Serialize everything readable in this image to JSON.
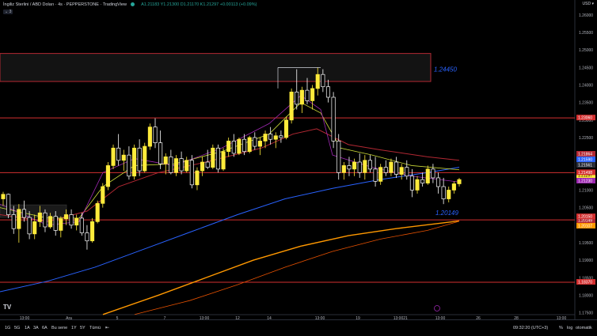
{
  "header": {
    "symbol": "İngiliz Sterlini / ABD Doları · 4s · PEPPERSTONE · TradingView",
    "ohlc": "A1.21183  Y1.21300  D1.21170  K1.21297  +0.00113 (+0.09%)",
    "collapse_label": "3",
    "currency": "USD ▾"
  },
  "chart_data": {
    "type": "line",
    "y_ticks": [
      "1.26000",
      "1.25500",
      "1.25000",
      "1.24500",
      "1.24000",
      "1.23500",
      "1.23000",
      "1.22500",
      "1.22000",
      "1.21500",
      "1.21000",
      "1.20500",
      "1.20000",
      "1.19500",
      "1.19000",
      "1.18500",
      "1.18000",
      "1.17500"
    ],
    "x_ticks": [
      "13:00",
      "Ara",
      "5",
      "7",
      "13:00",
      "12",
      "14",
      "13:00",
      "19",
      "13:00",
      "21",
      "13:00",
      "26",
      "28",
      "13:00"
    ],
    "zone_label": "1.24450",
    "support_label": "1.20149",
    "hlines": [
      {
        "price": 1.2306,
        "label": "1.23060"
      },
      {
        "price": 1.21498,
        "label": "1.21498"
      },
      {
        "price": 1.2015,
        "label": "1.20150"
      },
      {
        "price": 1.1837,
        "label": "1.18370"
      }
    ],
    "price_badges": [
      {
        "label": "1.21864",
        "color": "#b22833"
      },
      {
        "label": "1.21590",
        "color": "#2962ff"
      },
      {
        "label": "1.21561",
        "color": "#2a2e39"
      },
      {
        "label": "1.21297",
        "color": "#ffeb3b"
      },
      {
        "label": "1.21230",
        "color": "#9c27b0"
      },
      {
        "label": "1.20149",
        "color": "#b22833"
      },
      {
        "label": "1.20107",
        "color": "#ff9800"
      }
    ],
    "candles": [
      [
        1.2075,
        1.2095,
        1.2055,
        1.2088
      ],
      [
        1.2088,
        1.209,
        1.202,
        1.203
      ],
      [
        1.203,
        1.2055,
        1.1975,
        1.199
      ],
      [
        1.199,
        1.206,
        1.195,
        1.2045
      ],
      [
        1.2045,
        1.207,
        1.201,
        1.2022
      ],
      [
        1.2022,
        1.204,
        1.196,
        1.1975
      ],
      [
        1.1975,
        1.203,
        1.196,
        1.201
      ],
      [
        1.201,
        1.2055,
        1.1995,
        1.2035
      ],
      [
        1.2035,
        1.2045,
        1.198,
        1.1995
      ],
      [
        1.1995,
        1.2035,
        1.199,
        1.2025
      ],
      [
        1.2025,
        1.204,
        1.197,
        1.1985
      ],
      [
        1.1985,
        1.2025,
        1.1965,
        1.2018
      ],
      [
        1.2018,
        1.2045,
        1.2,
        1.203
      ],
      [
        1.203,
        1.2045,
        1.199,
        1.2
      ],
      [
        1.2,
        1.203,
        1.1985,
        1.202
      ],
      [
        1.202,
        1.2035,
        1.197,
        1.1978
      ],
      [
        1.1978,
        1.2,
        1.193,
        1.1955
      ],
      [
        1.1955,
        1.202,
        1.195,
        1.201
      ],
      [
        1.201,
        1.207,
        1.2005,
        1.2062
      ],
      [
        1.2062,
        1.212,
        1.205,
        1.211
      ],
      [
        1.211,
        1.218,
        1.21,
        1.217
      ],
      [
        1.217,
        1.223,
        1.216,
        1.222
      ],
      [
        1.222,
        1.226,
        1.217,
        1.2185
      ],
      [
        1.2185,
        1.2215,
        1.2155,
        1.22
      ],
      [
        1.22,
        1.2225,
        1.213,
        1.214
      ],
      [
        1.214,
        1.223,
        1.213,
        1.222
      ],
      [
        1.222,
        1.2245,
        1.214,
        1.2155
      ],
      [
        1.2155,
        1.2235,
        1.215,
        1.2225
      ],
      [
        1.2225,
        1.229,
        1.2215,
        1.228
      ],
      [
        1.228,
        1.2305,
        1.222,
        1.2235
      ],
      [
        1.2235,
        1.227,
        1.216,
        1.2175
      ],
      [
        1.2175,
        1.2205,
        1.2145,
        1.2195
      ],
      [
        1.2195,
        1.2215,
        1.2145,
        1.215
      ],
      [
        1.215,
        1.22,
        1.214,
        1.219
      ],
      [
        1.219,
        1.221,
        1.2145,
        1.2155
      ],
      [
        1.2155,
        1.2195,
        1.215,
        1.2185
      ],
      [
        1.2185,
        1.22,
        1.2105,
        1.2115
      ],
      [
        1.2115,
        1.2165,
        1.21,
        1.2155
      ],
      [
        1.2155,
        1.2195,
        1.214,
        1.218
      ],
      [
        1.218,
        1.2215,
        1.216,
        1.2165
      ],
      [
        1.2165,
        1.223,
        1.216,
        1.222
      ],
      [
        1.222,
        1.223,
        1.215,
        1.216
      ],
      [
        1.216,
        1.222,
        1.2155,
        1.221
      ],
      [
        1.221,
        1.225,
        1.2195,
        1.224
      ],
      [
        1.224,
        1.226,
        1.2195,
        1.2205
      ],
      [
        1.2205,
        1.225,
        1.22,
        1.2245
      ],
      [
        1.2245,
        1.226,
        1.22,
        1.221
      ],
      [
        1.221,
        1.2255,
        1.2205,
        1.225
      ],
      [
        1.225,
        1.2265,
        1.2215,
        1.2225
      ],
      [
        1.2225,
        1.225,
        1.22,
        1.224
      ],
      [
        1.224,
        1.227,
        1.222,
        1.226
      ],
      [
        1.226,
        1.228,
        1.223,
        1.2245
      ],
      [
        1.2245,
        1.2265,
        1.222,
        1.2255
      ],
      [
        1.2255,
        1.227,
        1.2235,
        1.225
      ],
      [
        1.225,
        1.231,
        1.2245,
        1.23
      ],
      [
        1.23,
        1.239,
        1.229,
        1.238
      ],
      [
        1.238,
        1.2445,
        1.233,
        1.2345
      ],
      [
        1.2345,
        1.2395,
        1.232,
        1.2385
      ],
      [
        1.2385,
        1.242,
        1.2345,
        1.2355
      ],
      [
        1.2355,
        1.24,
        1.233,
        1.239
      ],
      [
        1.239,
        1.245,
        1.237,
        1.243
      ],
      [
        1.243,
        1.2445,
        1.238,
        1.2395
      ],
      [
        1.2395,
        1.2415,
        1.235,
        1.2365
      ],
      [
        1.2365,
        1.238,
        1.222,
        1.224
      ],
      [
        1.224,
        1.226,
        1.213,
        1.215
      ],
      [
        1.215,
        1.218,
        1.213,
        1.217
      ],
      [
        1.217,
        1.2195,
        1.214,
        1.216
      ],
      [
        1.216,
        1.219,
        1.214,
        1.218
      ],
      [
        1.218,
        1.2205,
        1.2135,
        1.215
      ],
      [
        1.215,
        1.22,
        1.213,
        1.2185
      ],
      [
        1.2185,
        1.22,
        1.215,
        1.216
      ],
      [
        1.216,
        1.2195,
        1.211,
        1.2125
      ],
      [
        1.2125,
        1.2175,
        1.2115,
        1.2165
      ],
      [
        1.2165,
        1.2185,
        1.214,
        1.215
      ],
      [
        1.215,
        1.219,
        1.214,
        1.218
      ],
      [
        1.218,
        1.2195,
        1.2135,
        1.2145
      ],
      [
        1.2145,
        1.2175,
        1.213,
        1.2165
      ],
      [
        1.2165,
        1.2185,
        1.213,
        1.214
      ],
      [
        1.214,
        1.216,
        1.208,
        1.21
      ],
      [
        1.21,
        1.214,
        1.209,
        1.213
      ],
      [
        1.213,
        1.215,
        1.211,
        1.212
      ],
      [
        1.212,
        1.217,
        1.2115,
        1.216
      ],
      [
        1.216,
        1.2175,
        1.212,
        1.2135
      ],
      [
        1.2135,
        1.215,
        1.209,
        1.211
      ],
      [
        1.211,
        1.2135,
        1.206,
        1.2075
      ],
      [
        1.2075,
        1.211,
        1.2065,
        1.21
      ],
      [
        1.21,
        1.2125,
        1.209,
        1.2118
      ],
      [
        1.2118,
        1.2135,
        1.211,
        1.213
      ]
    ]
  },
  "timeframes": [
    "1G",
    "5G",
    "1A",
    "3A",
    "6A",
    "Bu sene",
    "1Y",
    "5Y",
    "Tümü"
  ],
  "clock": "09:32:20 (UTC+3)",
  "options": [
    "%",
    "log",
    "otomatik"
  ],
  "logo": "TV"
}
